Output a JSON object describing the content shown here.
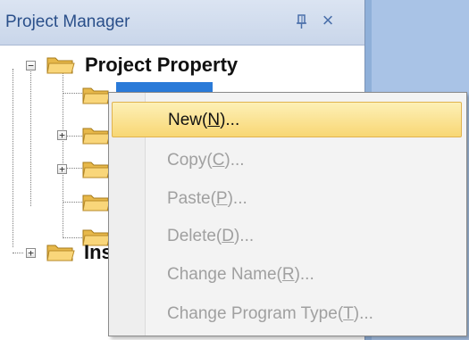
{
  "panel": {
    "title": "Project Manager",
    "pin_icon": "pin-icon",
    "close_label": "×"
  },
  "tree": {
    "root_label": "Project Property",
    "child_label_partial": "Ins",
    "expand_minus": "−",
    "expand_plus": "+"
  },
  "context_menu": {
    "items": [
      {
        "label_prefix": "New(",
        "mnemonic": "N",
        "label_suffix": ")...",
        "enabled": true
      },
      {
        "label_prefix": "Copy(",
        "mnemonic": "C",
        "label_suffix": ")...",
        "enabled": false
      },
      {
        "label_prefix": "Paste(",
        "mnemonic": "P",
        "label_suffix": ")...",
        "enabled": false
      },
      {
        "label_prefix": "Delete(",
        "mnemonic": "D",
        "label_suffix": ")...",
        "enabled": false
      },
      {
        "label_prefix": "Change Name(",
        "mnemonic": "R",
        "label_suffix": ")...",
        "enabled": false
      },
      {
        "label_prefix": "Change Program Type(",
        "mnemonic": "T",
        "label_suffix": ")...",
        "enabled": false
      }
    ]
  },
  "colors": {
    "selection": "#2a7ad8",
    "menu_hover": "#f8d774",
    "header_text": "#2a4f8a",
    "workspace": "#a9c3e6"
  }
}
